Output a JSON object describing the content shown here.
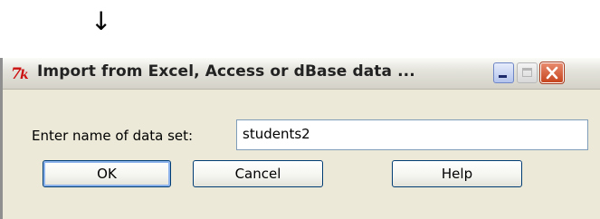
{
  "decoration": {
    "arrow": "↓"
  },
  "window": {
    "title": "Import from Excel, Access or dBase data ...",
    "app_icon": "tk-feather-icon",
    "controls": [
      "minimize-icon",
      "maximize-icon",
      "close-icon"
    ]
  },
  "form": {
    "dataset_label": "Enter name of data set:",
    "dataset_value": "students2"
  },
  "buttons": {
    "ok": "OK",
    "cancel": "Cancel",
    "help": "Help"
  },
  "colors": {
    "dialog_bg": "#ece9d8",
    "close_button": "#c6451f",
    "focus_border": "#003c74"
  }
}
